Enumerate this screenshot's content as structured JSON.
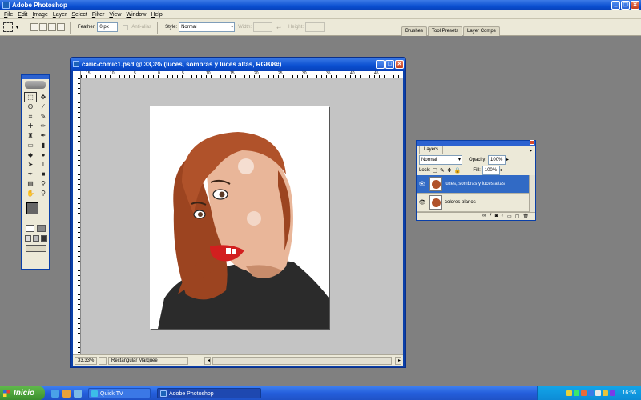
{
  "app": {
    "title": "Adobe Photoshop"
  },
  "menu": [
    "File",
    "Edit",
    "Image",
    "Layer",
    "Select",
    "Filter",
    "View",
    "Window",
    "Help"
  ],
  "options": {
    "feather_label": "Feather:",
    "feather_value": "0 px",
    "antialias_label": "Anti-alias",
    "style_label": "Style:",
    "style_value": "Normal",
    "width_label": "Width:",
    "height_label": "Height:",
    "well_tabs": [
      "Brushes",
      "Tool Presets",
      "Layer Comps"
    ]
  },
  "document": {
    "title": "caric-comic1.psd @ 33,3% (luces, sombras y luces altas, RGB/8#)",
    "zoom": "33,33%",
    "status_tool": "Rectangular Marquee",
    "ruler_top": [
      "15",
      "10",
      "5",
      "0",
      "5",
      "10",
      "15",
      "20",
      "25",
      "30",
      "35",
      "40",
      "45"
    ]
  },
  "layers_panel": {
    "tab": "Layers",
    "blend_mode": "Normal",
    "opacity_label": "Opacity:",
    "opacity_value": "100%",
    "lock_label": "Lock:",
    "fill_label": "Fill:",
    "fill_value": "100%",
    "layers": [
      {
        "name": "luces, sombras y luces altas",
        "selected": true
      },
      {
        "name": "colores planos",
        "selected": false
      }
    ]
  },
  "taskbar": {
    "start_label": "Inicio",
    "tasks": [
      "Quick TV",
      "Adobe Photoshop"
    ],
    "clock": "16:56"
  },
  "colors": {
    "xp_blue": "#0a4fd1",
    "selected_layer": "#316ac5",
    "hair": "#b0522a",
    "sweater": "#2a2a2a"
  }
}
